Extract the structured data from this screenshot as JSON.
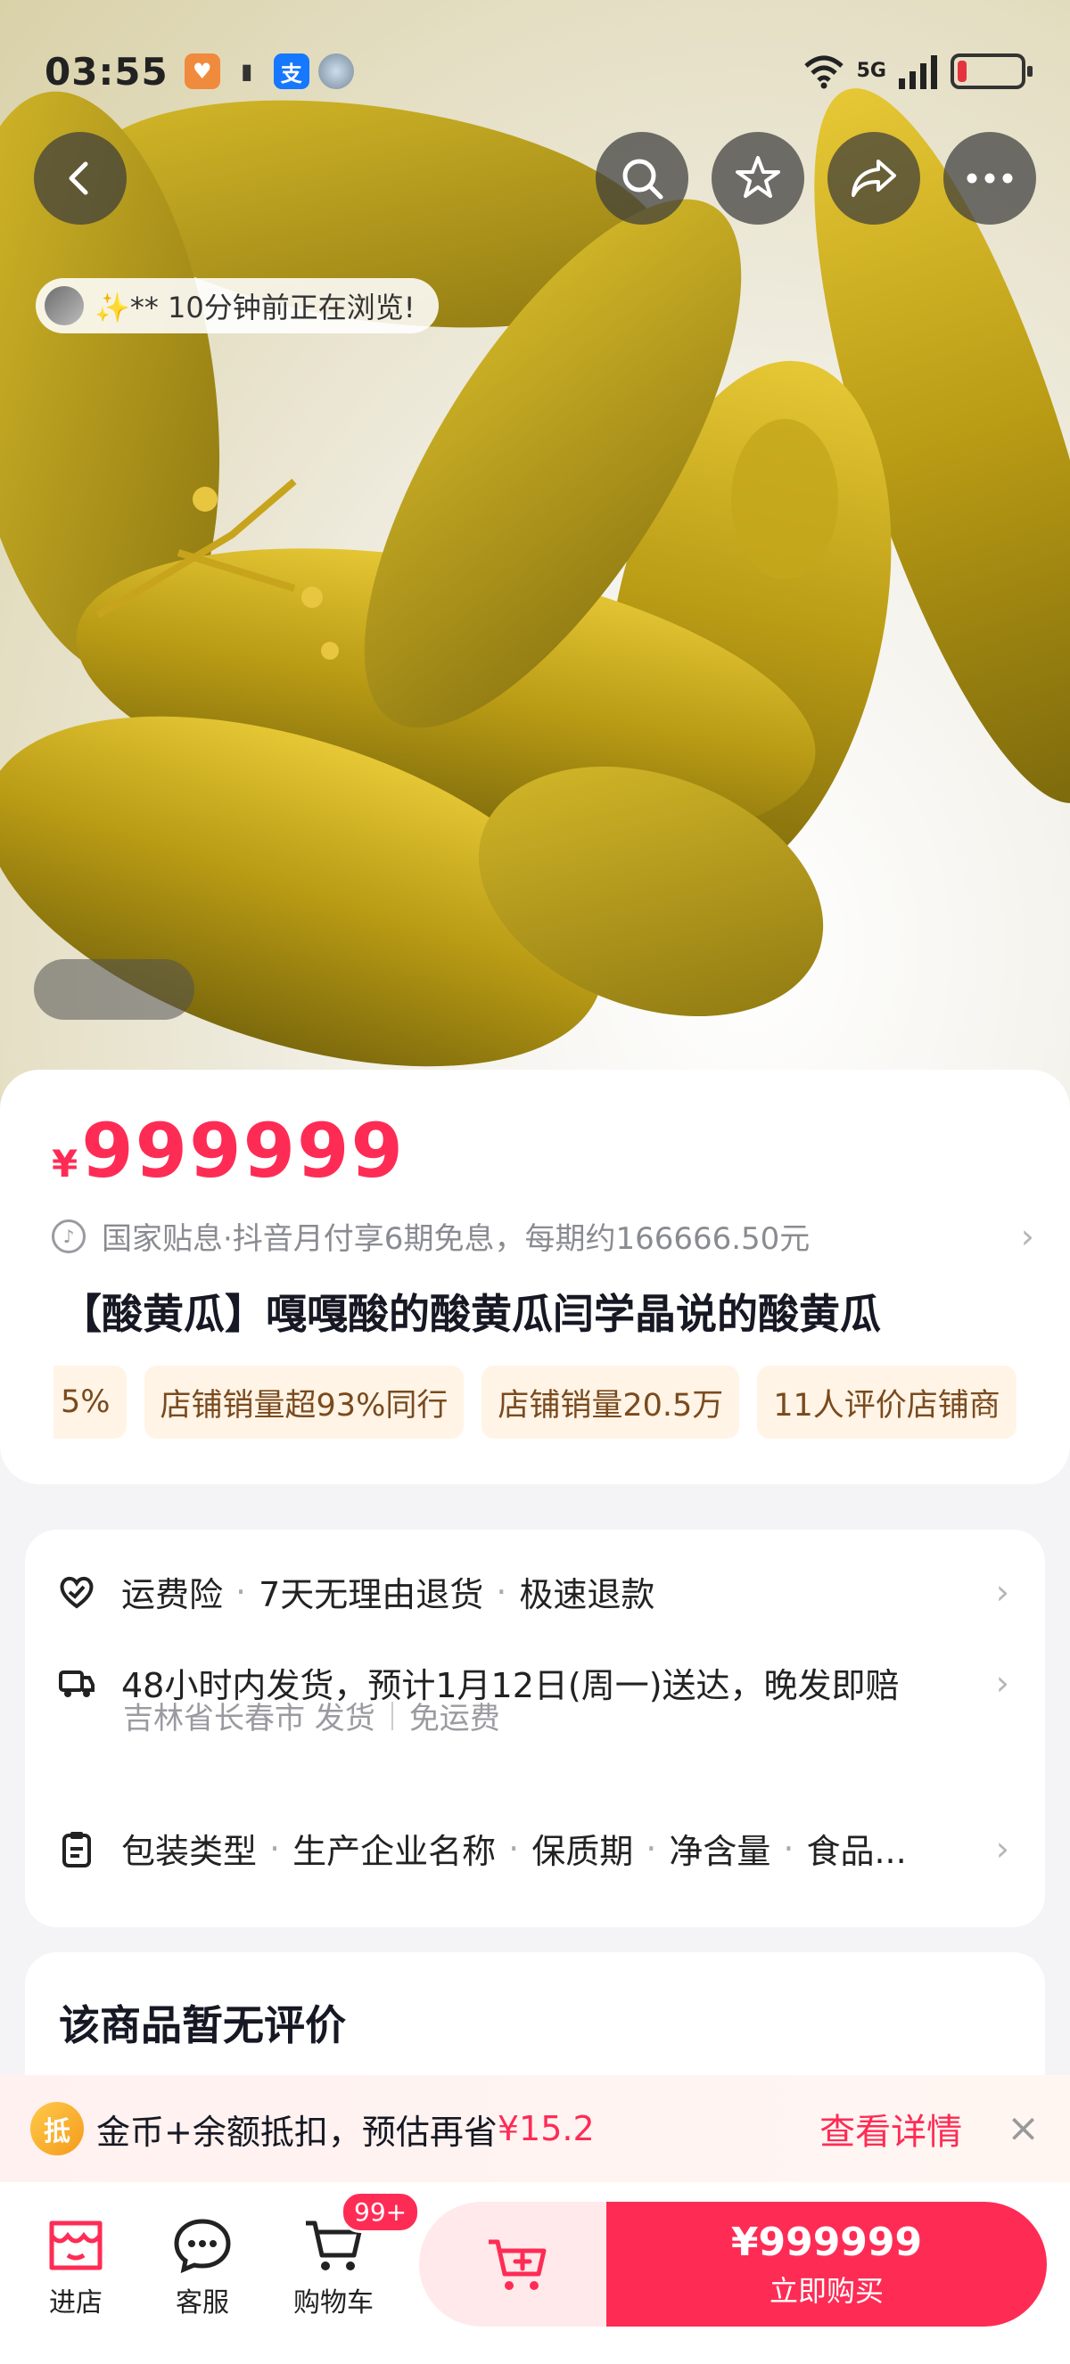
{
  "status_bar": {
    "time": "03:55",
    "network": "5G",
    "battery_level": 0.15
  },
  "hero": {
    "browse_notice": "✨** 10分钟前正在浏览!"
  },
  "product": {
    "currency": "¥",
    "price": "999999",
    "installment": "国家贴息·抖音月付享6期免息，每期约166666.50元",
    "title": "【酸黄瓜】嘎嘎酸的酸黄瓜闫学晶说的酸黄瓜",
    "tags": [
      "5%",
      "店铺销量超93%同行",
      "店铺销量20.5万",
      "11人评价店铺商"
    ]
  },
  "services": {
    "row1": [
      "运费险",
      "7天无理由退货",
      "极速退款"
    ],
    "row2": "48小时内发货，预计1月12日(周一)送达，晚发即赔",
    "row2_sub_origin": "吉林省长春市 发货",
    "row2_sub_fee": "免运费",
    "row3": [
      "包装类型",
      "生产企业名称",
      "保质期",
      "净含量",
      "食品..."
    ]
  },
  "reviews": {
    "title": "该商品暂无评价"
  },
  "coin_banner": {
    "icon_text": "抵",
    "text": "金币+余额抵扣，预估再省",
    "amount": "¥15.2",
    "detail": "查看详情"
  },
  "bottom_bar": {
    "shop": "进店",
    "service": "客服",
    "cart": "购物车",
    "cart_badge": "99+",
    "buy_price": "¥999999",
    "buy_label": "立即购买"
  },
  "colors": {
    "accent": "#fe2c55",
    "tag_bg": "#fff4e6",
    "tag_text": "#7a4a1e"
  }
}
